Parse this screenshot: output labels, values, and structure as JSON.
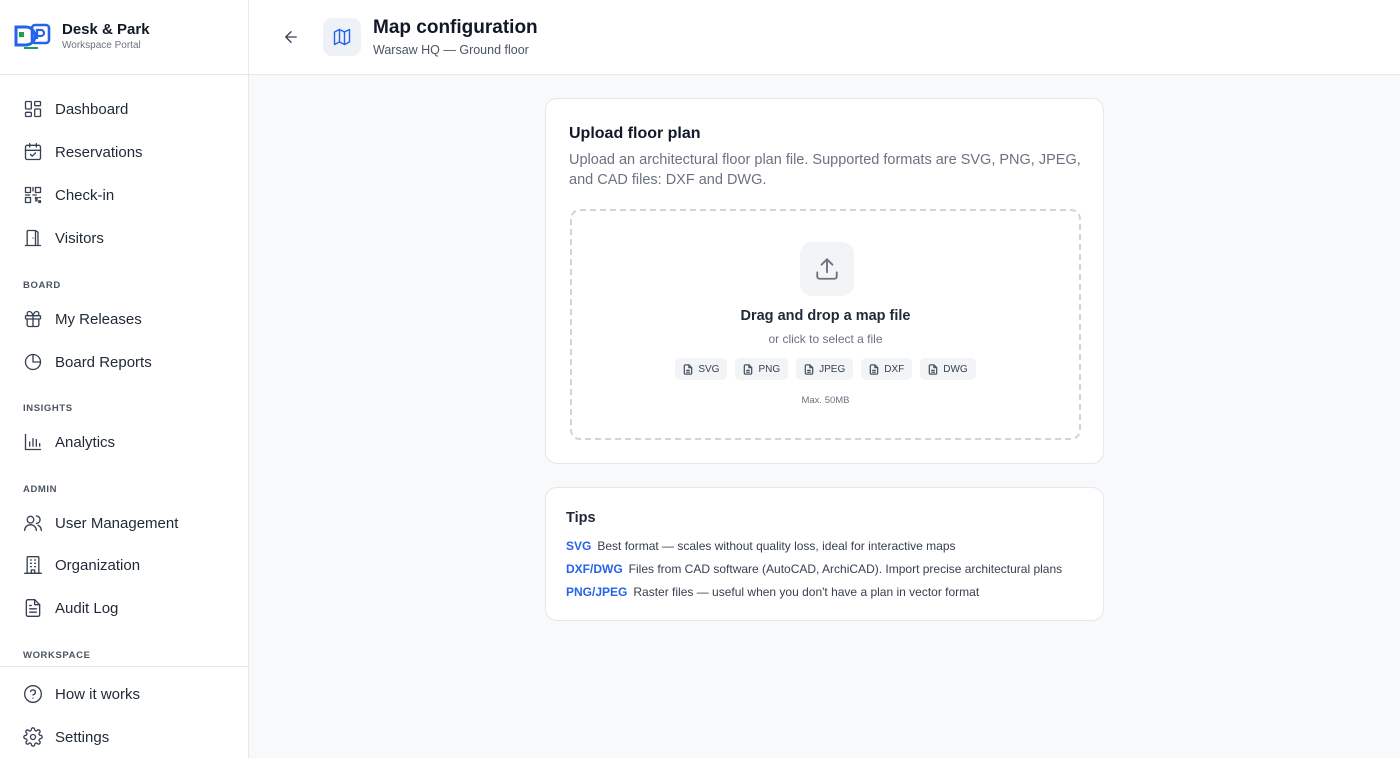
{
  "brand": {
    "name": "Desk & Park",
    "subtitle": "Workspace Portal"
  },
  "nav": {
    "main": [
      {
        "label": "Dashboard",
        "icon": "dashboard-icon"
      },
      {
        "label": "Reservations",
        "icon": "calendar-check-icon"
      },
      {
        "label": "Check-in",
        "icon": "qr-code-icon"
      },
      {
        "label": "Visitors",
        "icon": "door-icon"
      }
    ],
    "board_label": "BOARD",
    "board": [
      {
        "label": "My Releases",
        "icon": "gift-icon"
      },
      {
        "label": "Board Reports",
        "icon": "pie-chart-icon"
      }
    ],
    "insights_label": "INSIGHTS",
    "insights": [
      {
        "label": "Analytics",
        "icon": "bar-chart-icon"
      }
    ],
    "admin_label": "ADMIN",
    "admin": [
      {
        "label": "User Management",
        "icon": "users-icon"
      },
      {
        "label": "Organization",
        "icon": "building-icon"
      },
      {
        "label": "Audit Log",
        "icon": "file-text-icon"
      }
    ],
    "workspace_label": "WORKSPACE",
    "bottom": [
      {
        "label": "How it works",
        "icon": "help-circle-icon"
      },
      {
        "label": "Settings",
        "icon": "gear-icon"
      }
    ]
  },
  "header": {
    "title": "Map configuration",
    "subtitle": "Warsaw HQ — Ground floor"
  },
  "upload": {
    "title": "Upload floor plan",
    "description": "Upload an architectural floor plan file. Supported formats are SVG, PNG, JPEG, and CAD files: DXF and DWG.",
    "drop_title": "Drag and drop a map file",
    "drop_sub": "or click to select a file",
    "formats": [
      "SVG",
      "PNG",
      "JPEG",
      "DXF",
      "DWG"
    ],
    "max_size": "Max. 50MB"
  },
  "tips": {
    "title": "Tips",
    "items": [
      {
        "key": "SVG",
        "text": "Best format — scales without quality loss, ideal for interactive maps"
      },
      {
        "key": "DXF/DWG",
        "text": "Files from CAD software (AutoCAD, ArchiCAD). Import precise architectural plans"
      },
      {
        "key": "PNG/JPEG",
        "text": "Raster files — useful when you don't have a plan in vector format"
      }
    ]
  },
  "colors": {
    "accent": "#2563eb",
    "border": "#e5e7eb",
    "background": "#f8f9fb"
  }
}
